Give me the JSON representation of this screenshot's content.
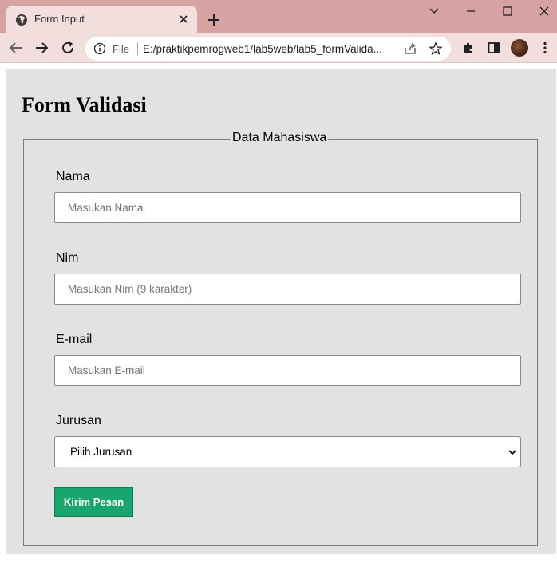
{
  "browser": {
    "tab_title": "Form Input",
    "address": {
      "scheme": "File",
      "url": "E:/praktikpemrogweb1/lab5web/lab5_formValida..."
    },
    "icons": {
      "tab": "globe-icon",
      "close": "close-icon",
      "new_tab": "plus-icon",
      "back": "back-arrow-icon",
      "forward": "forward-arrow-icon",
      "reload": "reload-icon",
      "info": "info-icon",
      "share": "share-icon",
      "bookmark": "star-icon",
      "extensions": "puzzle-icon",
      "side_panel": "side-panel-icon",
      "menu": "kebab-menu-icon"
    },
    "colors": {
      "tab_strip": "#d7a2a3",
      "toolbar": "#f3dede"
    }
  },
  "page": {
    "title": "Form Validasi",
    "background": "#e2e2e2",
    "form": {
      "legend": "Data Mahasiswa",
      "fields": [
        {
          "label": "Nama",
          "placeholder": "Masukan Nama",
          "value": ""
        },
        {
          "label": "Nim",
          "placeholder": "Masukan Nim (9 karakter)",
          "value": ""
        },
        {
          "label": "E-mail",
          "placeholder": "Masukan E-mail",
          "value": ""
        }
      ],
      "select": {
        "label": "Jurusan",
        "selected": "Pilih Jurusan"
      },
      "submit_label": "Kirim Pesan",
      "submit_color": "#18a56f"
    }
  }
}
